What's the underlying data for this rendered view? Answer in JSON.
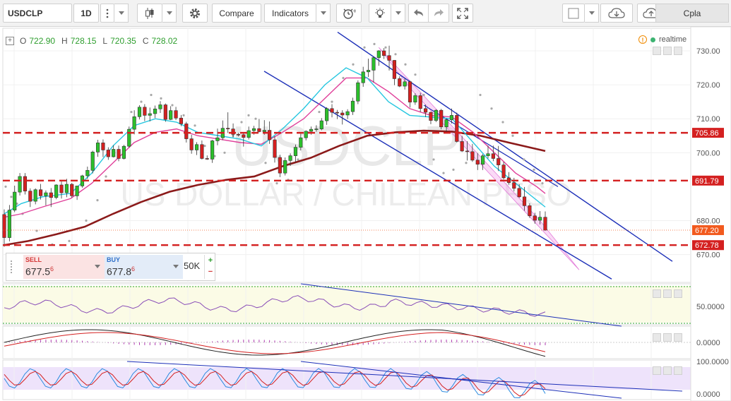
{
  "toolbar": {
    "symbol": "USDCLP",
    "interval": "1D",
    "compare_label": "Compare",
    "indicators_label": "Indicators",
    "account_label": "Cpla"
  },
  "legend": {
    "open_label": "O",
    "open": "722.90",
    "high_label": "H",
    "high": "728.15",
    "low_label": "L",
    "low": "720.35",
    "close_label": "C",
    "close": "728.02",
    "realtime_label": "realtime"
  },
  "watermark": {
    "symbol": "USDCLP",
    "description": "US DOLLAR / CHILEAN PESO"
  },
  "trade": {
    "sell_label": "SELL",
    "sell_price": "677.5",
    "sell_sup": "6",
    "buy_label": "BUY",
    "buy_price": "677.8",
    "buy_sup": "6",
    "quantity": "50K",
    "plus": "+",
    "minus": "−"
  },
  "price_axis": {
    "ticks": [
      "730.00",
      "720.00",
      "710.00",
      "700.00",
      "680.00",
      "670.00"
    ],
    "levels": [
      {
        "value": "705.86",
        "color": "#d42020"
      },
      {
        "value": "691.79",
        "color": "#d42020"
      },
      {
        "value": "677.20",
        "color": "#f25a1e"
      },
      {
        "value": "672.78",
        "color": "#d42020"
      }
    ]
  },
  "rsi_axis": {
    "ticks": [
      "50.0000"
    ]
  },
  "macd_axis": {
    "ticks": [
      "0.0000"
    ]
  },
  "stoch_axis": {
    "ticks": [
      "100.0000",
      "0.0000"
    ]
  },
  "colors": {
    "up": "#2bbf2b",
    "down": "#d42020",
    "ema_fast": "#27c7e0",
    "ema_mid": "#e0409a",
    "sma_slow": "#8b1a1a",
    "channel": "#1c2fb8",
    "sar": "#a8a8a8"
  },
  "chart_data": {
    "type": "candlestick",
    "symbol": "USDCLP",
    "interval": "1D",
    "y_range": [
      664,
      735
    ],
    "horizontal_levels": [
      705.86,
      691.79,
      677.2,
      672.78
    ],
    "candles": [
      [
        681.8,
        683.3,
        672.3,
        675.0
      ],
      [
        675.0,
        684.6,
        673.9,
        683.1
      ],
      [
        683.1,
        690.3,
        682.5,
        688.4
      ],
      [
        688.4,
        694.0,
        687.4,
        693.0
      ],
      [
        693.0,
        694.0,
        687.7,
        688.7
      ],
      [
        688.7,
        689.5,
        684.0,
        685.7
      ],
      [
        685.7,
        689.5,
        684.8,
        689.1
      ],
      [
        689.1,
        690.8,
        686.2,
        687.3
      ],
      [
        687.3,
        688.9,
        684.5,
        688.2
      ],
      [
        688.2,
        689.6,
        684.0,
        686.8
      ],
      [
        686.8,
        690.7,
        686.3,
        690.5
      ],
      [
        690.5,
        691.5,
        686.5,
        688.2
      ],
      [
        688.2,
        692.3,
        686.9,
        690.7
      ],
      [
        690.7,
        691.1,
        686.8,
        687.3
      ],
      [
        687.3,
        690.3,
        686.1,
        690.2
      ],
      [
        690.2,
        693.5,
        689.7,
        693.2
      ],
      [
        693.2,
        695.9,
        692.3,
        694.8
      ],
      [
        694.8,
        700.6,
        693.9,
        700.2
      ],
      [
        700.2,
        703.8,
        698.8,
        702.9
      ],
      [
        702.9,
        703.9,
        698.7,
        700.8
      ],
      [
        700.8,
        701.6,
        697.9,
        698.8
      ],
      [
        698.8,
        702.2,
        698.6,
        701.0
      ],
      [
        701.0,
        702.1,
        697.5,
        698.3
      ],
      [
        698.3,
        702.3,
        698.0,
        701.9
      ],
      [
        701.9,
        707.7,
        701.5,
        706.9
      ],
      [
        706.9,
        712.5,
        705.4,
        710.6
      ],
      [
        710.6,
        714.0,
        709.8,
        713.4
      ],
      [
        713.4,
        714.3,
        709.3,
        711.0
      ],
      [
        711.0,
        713.3,
        709.2,
        711.5
      ],
      [
        711.5,
        713.9,
        710.2,
        712.9
      ],
      [
        712.9,
        715.2,
        711.7,
        714.1
      ],
      [
        714.1,
        714.5,
        709.1,
        709.8
      ],
      [
        709.8,
        713.7,
        709.6,
        712.4
      ],
      [
        712.4,
        713.5,
        709.6,
        710.2
      ],
      [
        710.2,
        711.1,
        707.8,
        708.5
      ],
      [
        708.5,
        709.1,
        703.0,
        704.1
      ],
      [
        704.1,
        705.3,
        699.7,
        700.8
      ],
      [
        700.8,
        703.1,
        699.3,
        702.4
      ],
      [
        702.4,
        703.6,
        698.0,
        698.3
      ],
      [
        698.3,
        699.2,
        697.9,
        698.1
      ],
      [
        698.1,
        703.8,
        697.0,
        703.5
      ],
      [
        703.5,
        707.1,
        702.2,
        704.4
      ],
      [
        704.4,
        709.5,
        703.7,
        707.2
      ],
      [
        707.2,
        711.9,
        705.8,
        707.0
      ],
      [
        707.0,
        708.6,
        704.5,
        705.4
      ],
      [
        705.4,
        705.8,
        704.8,
        705.3
      ],
      [
        705.3,
        705.7,
        701.8,
        704.5
      ],
      [
        704.5,
        707.7,
        703.9,
        706.5
      ],
      [
        706.5,
        707.9,
        705.3,
        707.1
      ],
      [
        707.1,
        709.9,
        706.0,
        706.2
      ],
      [
        706.2,
        709.6,
        705.3,
        706.6
      ],
      [
        706.6,
        709.2,
        702.6,
        703.8
      ],
      [
        703.8,
        704.9,
        697.1,
        698.6
      ],
      [
        698.6,
        699.4,
        692.8,
        694.0
      ],
      [
        694.0,
        698.6,
        693.3,
        697.7
      ],
      [
        697.7,
        699.8,
        696.1,
        699.1
      ],
      [
        699.1,
        702.4,
        697.2,
        701.6
      ],
      [
        701.6,
        705.6,
        700.7,
        704.4
      ],
      [
        704.4,
        706.6,
        703.6,
        706.3
      ],
      [
        706.3,
        707.7,
        705.3,
        706.9
      ],
      [
        706.9,
        708.1,
        706.2,
        707.0
      ],
      [
        707.0,
        710.2,
        706.6,
        709.4
      ],
      [
        709.4,
        713.4,
        708.2,
        713.0
      ],
      [
        713.0,
        714.3,
        710.4,
        711.9
      ],
      [
        711.9,
        712.6,
        709.9,
        711.7
      ],
      [
        711.7,
        712.5,
        708.3,
        711.1
      ],
      [
        711.1,
        712.8,
        709.9,
        712.1
      ],
      [
        712.1,
        716.2,
        711.1,
        715.2
      ],
      [
        715.2,
        721.3,
        714.3,
        720.6
      ],
      [
        720.6,
        725.3,
        719.4,
        723.8
      ],
      [
        723.8,
        727.7,
        722.3,
        724.3
      ],
      [
        724.3,
        728.3,
        720.7,
        728.0
      ],
      [
        728.0,
        730.2,
        725.6,
        730.0
      ],
      [
        730.0,
        730.8,
        727.6,
        728.6
      ],
      [
        728.6,
        731.5,
        724.2,
        727.2
      ],
      [
        727.2,
        727.3,
        719.9,
        721.8
      ],
      [
        721.8,
        722.5,
        719.3,
        719.6
      ],
      [
        719.6,
        721.8,
        718.6,
        720.9
      ],
      [
        720.9,
        721.2,
        713.3,
        714.9
      ],
      [
        714.9,
        717.5,
        714.1,
        716.8
      ],
      [
        716.8,
        717.6,
        712.0,
        713.0
      ],
      [
        713.0,
        714.2,
        710.5,
        711.9
      ],
      [
        711.9,
        712.1,
        708.4,
        709.5
      ],
      [
        709.5,
        712.8,
        709.0,
        712.5
      ],
      [
        712.5,
        712.9,
        706.9,
        707.6
      ],
      [
        707.6,
        710.1,
        706.1,
        709.7
      ],
      [
        709.7,
        713.0,
        708.6,
        711.0
      ],
      [
        711.0,
        711.8,
        703.0,
        703.3
      ],
      [
        703.3,
        705.0,
        700.2,
        700.5
      ],
      [
        700.5,
        703.4,
        697.7,
        700.3
      ],
      [
        700.3,
        702.6,
        697.3,
        697.8
      ],
      [
        697.8,
        699.9,
        694.9,
        696.6
      ],
      [
        696.6,
        699.6,
        694.9,
        699.1
      ],
      [
        699.1,
        702.1,
        698.3,
        699.7
      ],
      [
        699.7,
        702.1,
        697.5,
        698.3
      ],
      [
        698.3,
        702.0,
        694.6,
        696.4
      ],
      [
        696.4,
        697.3,
        692.1,
        692.6
      ],
      [
        692.6,
        694.3,
        690.6,
        691.2
      ],
      [
        691.2,
        692.6,
        688.6,
        689.5
      ],
      [
        689.5,
        690.7,
        686.7,
        687.0
      ],
      [
        687.0,
        689.9,
        682.9,
        684.4
      ],
      [
        684.4,
        685.1,
        680.8,
        681.4
      ],
      [
        681.4,
        682.3,
        679.1,
        680.1
      ],
      [
        680.1,
        682.8,
        678.9,
        681.0
      ],
      [
        681.0,
        682.7,
        677.0,
        677.2
      ]
    ],
    "indicators": [
      "EMA fast",
      "EMA mid",
      "SMA slow",
      "Parabolic SAR",
      "Regression channels",
      "RSI",
      "MACD",
      "Stochastic"
    ],
    "x_labels": []
  }
}
